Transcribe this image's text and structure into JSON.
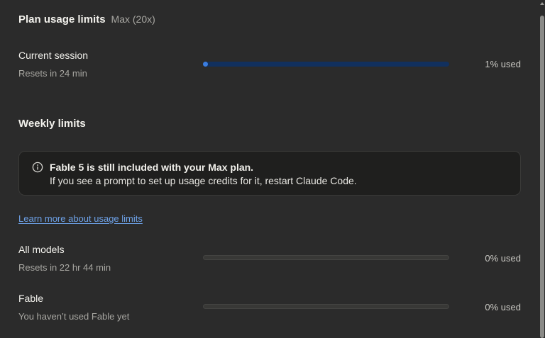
{
  "header": {
    "title": "Plan usage limits",
    "plan": "Max (20x)"
  },
  "session": {
    "title": "Current session",
    "reset": "Resets in 24 min",
    "used_label": "1% used",
    "used_percent": 1
  },
  "weekly": {
    "title": "Weekly limits",
    "notice": {
      "icon": "info-icon",
      "line1": "Fable 5 is still included with your Max plan.",
      "line2": "If you see a prompt to set up usage credits for it, restart Claude Code."
    },
    "learn_more": "Learn more about usage limits",
    "rows": [
      {
        "title": "All models",
        "sub": "Resets in 22 hr 44 min",
        "used_label": "0% used",
        "used_percent": 0
      },
      {
        "title": "Fable",
        "sub": "You haven’t used Fable yet",
        "used_label": "0% used",
        "used_percent": 0
      }
    ]
  },
  "colors": {
    "accent": "#3b7de0",
    "link": "#6ea2e8",
    "background": "#2b2b2b"
  }
}
